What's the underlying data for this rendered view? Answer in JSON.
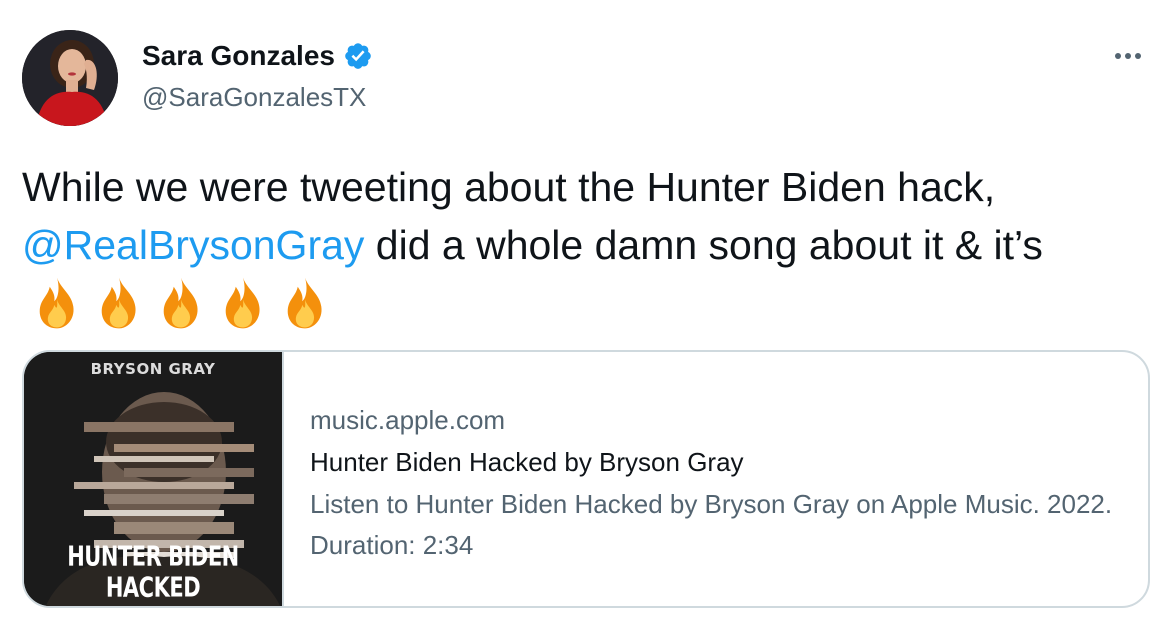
{
  "author": {
    "display_name": "Sara Gonzales",
    "handle": "@SaraGonzalesTX",
    "verified": true,
    "avatar_icon": "profile-photo"
  },
  "tweet": {
    "text_before": "While we were tweeting about the Hunter Biden hack, ",
    "mention": "@RealBrysonGray",
    "text_after": " did a whole damn song about it & it’s",
    "emoji": [
      "🔥",
      "🔥",
      "🔥",
      "🔥",
      "🔥"
    ]
  },
  "card": {
    "thumbnail_top_text": "BRYSON GRAY",
    "thumbnail_bottom_text": "HUNTER BIDEN HACKED",
    "domain": "music.apple.com",
    "title": "Hunter Biden Hacked by Bryson Gray",
    "description": "Listen to Hunter Biden Hacked by Bryson Gray on Apple Music. 2022. Duration: 2:34"
  },
  "colors": {
    "link": "#1d9bf0",
    "secondary_text": "#536471",
    "primary_text": "#0f1419",
    "border": "#cfd9de"
  },
  "icons": {
    "more": "more-horizontal-icon",
    "verified": "verified-badge-icon",
    "emoji": "fire-icon"
  }
}
